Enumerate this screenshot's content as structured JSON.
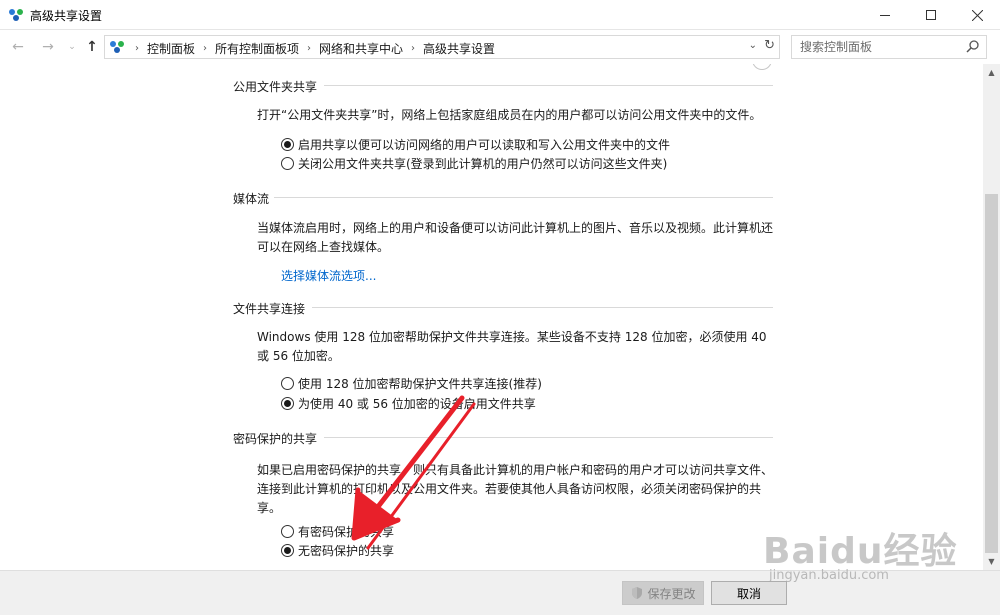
{
  "window": {
    "title": "高级共享设置"
  },
  "nav": {
    "back": "←",
    "forward": "→",
    "recent": "⌄",
    "up": "↑"
  },
  "address": {
    "crumbs": [
      "控制面板",
      "所有控制面板项",
      "网络和共享中心",
      "高级共享设置"
    ],
    "dropdown": "⌄",
    "refresh": "↻"
  },
  "search": {
    "placeholder": "搜索控制面板"
  },
  "sections": {
    "public_folder": {
      "title": "公用文件夹共享",
      "description": "打开“公用文件夹共享”时，网络上包括家庭组成员在内的用户都可以访问公用文件夹中的文件。",
      "options": [
        {
          "label": "启用共享以便可以访问网络的用户可以读取和写入公用文件夹中的文件",
          "checked": true
        },
        {
          "label": "关闭公用文件夹共享(登录到此计算机的用户仍然可以访问这些文件夹)",
          "checked": false
        }
      ]
    },
    "media": {
      "title": "媒体流",
      "description": "当媒体流启用时，网络上的用户和设备便可以访问此计算机上的图片、音乐以及视频。此计算机还可以在网络上查找媒体。",
      "link": "选择媒体流选项..."
    },
    "file_sharing": {
      "title": "文件共享连接",
      "description": "Windows 使用 128 位加密帮助保护文件共享连接。某些设备不支持 128 位加密，必须使用 40 或 56 位加密。",
      "options": [
        {
          "label": "使用 128 位加密帮助保护文件共享连接(推荐)",
          "checked": false
        },
        {
          "label": "为使用 40 或 56 位加密的设备启用文件共享",
          "checked": true
        }
      ]
    },
    "password": {
      "title": "密码保护的共享",
      "description": "如果已启用密码保护的共享，则只有具备此计算机的用户帐户和密码的用户才可以访问共享文件、连接到此计算机的打印机以及公用文件夹。若要使其他人具备访问权限，必须关闭密码保护的共享。",
      "options": [
        {
          "label": "有密码保护的共享",
          "checked": false
        },
        {
          "label": "无密码保护的共享",
          "checked": true
        }
      ]
    }
  },
  "footer": {
    "save_label": "保存更改",
    "cancel_label": "取消"
  },
  "watermark": {
    "main": "Baidu经验",
    "sub": "jingyan.baidu.com"
  },
  "colors": {
    "link": "#0066cc",
    "arrow": "#e8202a",
    "scroll_thumb": "#cdcdcd"
  }
}
